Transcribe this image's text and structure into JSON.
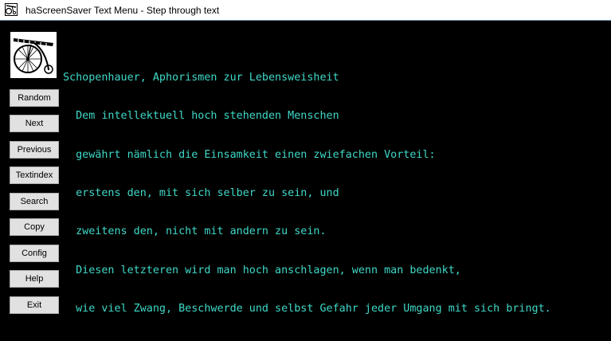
{
  "window": {
    "title": "haScreenSaver Text Menu - Step through text",
    "icon": "app-icon"
  },
  "sidebar": {
    "logo_icon": "penny-farthing-bicycle-icon",
    "buttons": [
      {
        "id": "random",
        "label": "Random"
      },
      {
        "id": "next",
        "label": "Next"
      },
      {
        "id": "previous",
        "label": "Previous"
      },
      {
        "id": "textindex",
        "label": "Textindex"
      },
      {
        "id": "search",
        "label": "Search"
      },
      {
        "id": "copy",
        "label": "Copy"
      },
      {
        "id": "config",
        "label": "Config"
      },
      {
        "id": "help",
        "label": "Help"
      },
      {
        "id": "exit",
        "label": "Exit"
      }
    ]
  },
  "content": {
    "text_color": "#3fd9c8",
    "background": "#000000",
    "lines": [
      "Schopenhauer, Aphorismen zur Lebensweisheit",
      "  Dem intellektuell hoch stehenden Menschen",
      "  gewährt nämlich die Einsamkeit einen zwiefachen Vorteil:",
      "  erstens den, mit sich selber zu sein, und",
      "  zweitens den, nicht mit andern zu sein.",
      "  Diesen letzteren wird man hoch anschlagen, wenn man bedenkt,",
      "  wie viel Zwang, Beschwerde und selbst Gefahr jeder Umgang mit sich bringt."
    ]
  }
}
